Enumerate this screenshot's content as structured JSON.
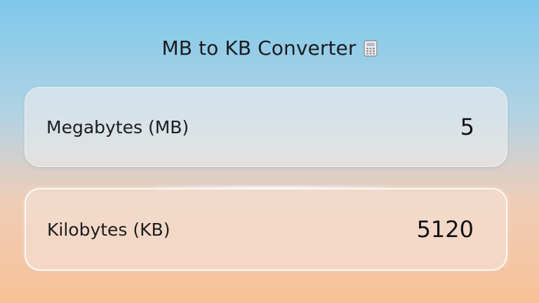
{
  "header": {
    "title": "MB to KB Converter",
    "icon": "calculator-icon"
  },
  "converter": {
    "megabytes": {
      "label": "Megabytes (MB)",
      "value": "5"
    },
    "kilobytes": {
      "label": "Kilobytes (KB)",
      "value": "5120"
    }
  },
  "colors": {
    "background_top": "#7ec8ec",
    "background_bottom": "#f8c196",
    "card_mb": "#ebecee",
    "card_kb": "#f3dcce",
    "text": "#1c1c1e"
  }
}
